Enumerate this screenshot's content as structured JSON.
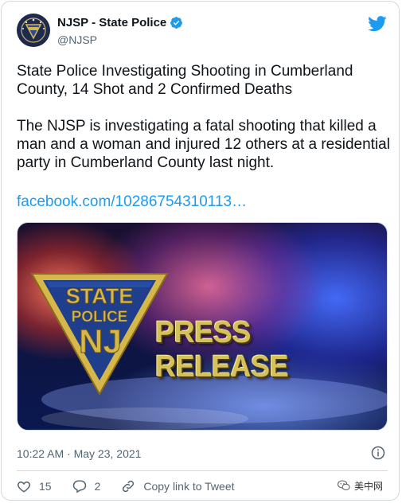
{
  "account": {
    "name": "NJSP - State Police",
    "handle": "@NJSP",
    "avatar_icon": "njsp-badge-icon",
    "verified_icon": "verified-badge-icon"
  },
  "tweet": {
    "headline": "State Police Investigating Shooting in Cumberland County, 14 Shot and 2 Confirmed Deaths",
    "body": "The NJSP is investigating a fatal shooting that killed a man and a woman and injured 12 others at a residential party in Cumberland County last night.",
    "link": "facebook.com/10286754310113…"
  },
  "media": {
    "badge_line1": "STATE",
    "badge_line2": "POLICE",
    "badge_line3": "NJ",
    "caption": "PRESS RELEASE"
  },
  "meta": {
    "timestamp": "10:22 AM · May 23, 2021",
    "info_icon": "info-icon"
  },
  "actions": {
    "likes": "15",
    "replies": "2",
    "copy_link": "Copy link to Tweet"
  },
  "watermark": {
    "text": "美中网"
  },
  "colors": {
    "accent": "#1d9bf0",
    "muted": "#536471",
    "border": "#cfd9de",
    "badge_gold": "#d6b84a",
    "badge_blue": "#1f3e8c"
  }
}
